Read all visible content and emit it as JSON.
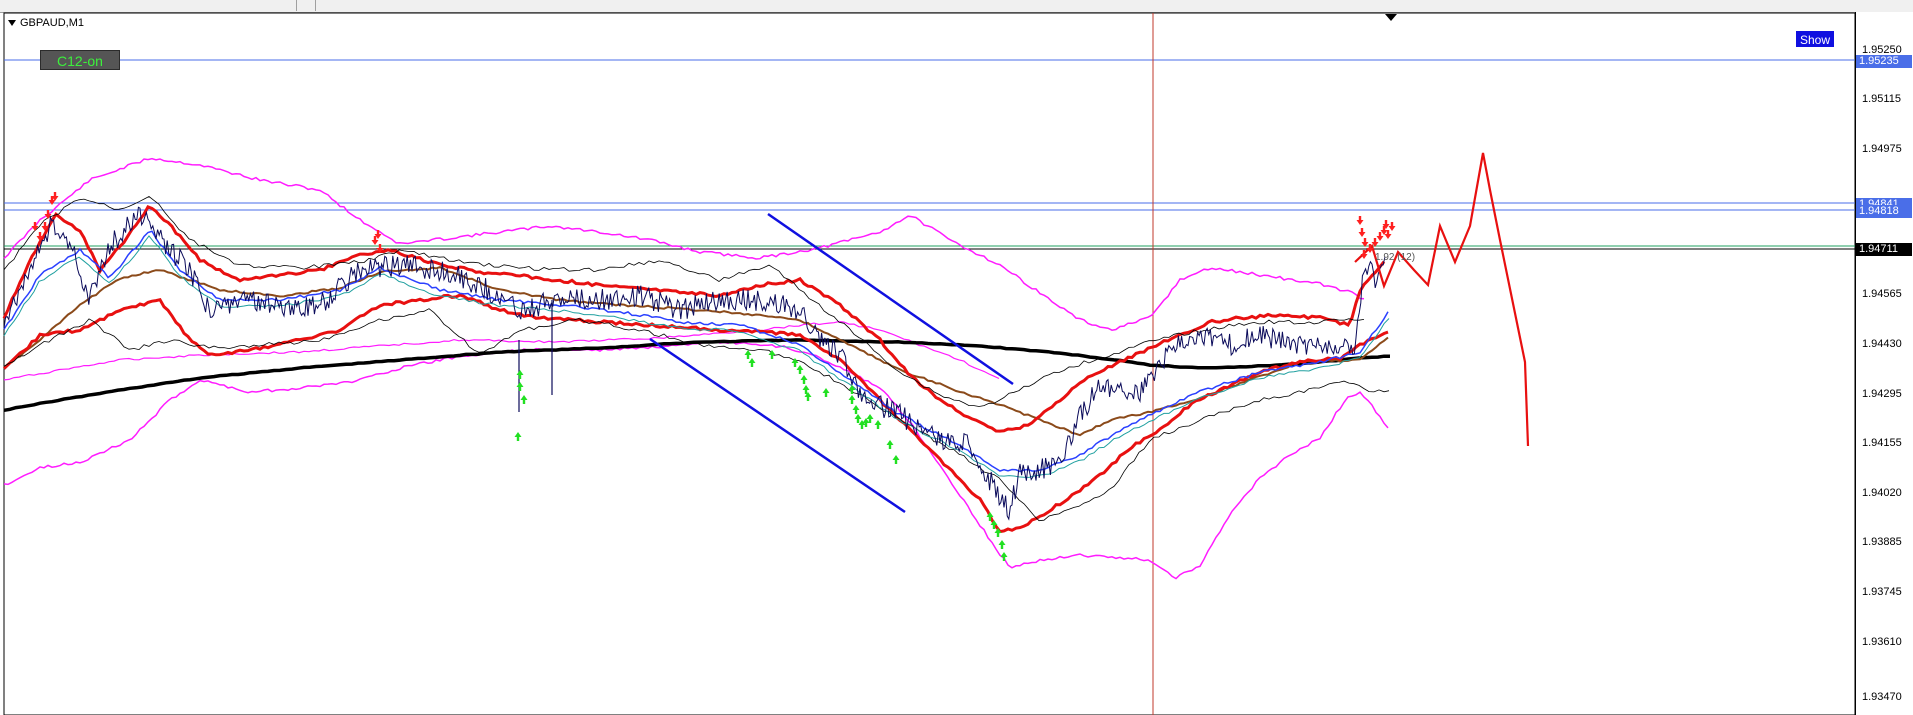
{
  "window": {
    "symbol": "GBPAUD,M1",
    "indicator_button": "C12-on",
    "show_button": "Show"
  },
  "price_axis": {
    "ticks": [
      "1.95250",
      "1.95115",
      "1.94975",
      "1.94565",
      "1.94430",
      "1.94295",
      "1.94155",
      "1.94020",
      "1.93885",
      "1.93745",
      "1.93610",
      "1.93470"
    ],
    "tags": [
      {
        "label": "1.95235",
        "bg": "#4a6ee8",
        "fg": "#ffffff"
      },
      {
        "label": "1.94841",
        "bg": "#4a6ee8",
        "fg": "#ffffff"
      },
      {
        "label": "1.94818",
        "bg": "#4a6ee8",
        "fg": "#ffffff"
      },
      {
        "label": "1.94711",
        "bg": "#000000",
        "fg": "#ffffff"
      }
    ]
  },
  "chart_labels": {
    "trade_label": "1.92 (12)"
  },
  "colors": {
    "envelope": "#ff1cff",
    "main_band": "#e81010",
    "slow_ma": "#000000",
    "mid_ma": "#8b4a1a",
    "price": "#0a0a5a",
    "trend_lines": "#1010e0",
    "buy_arrow": "#22e022",
    "sell_arrow": "#ff2020",
    "horizontal_level": "#4a6ee8",
    "vertical_marker": "#c0392b",
    "projection": "#e81010"
  },
  "icons": {
    "dropdown": "triangle-down-icon",
    "shift_marker": "chart-shift-icon",
    "buy_signal": "arrow-up-icon",
    "sell_signal": "arrow-down-icon"
  }
}
